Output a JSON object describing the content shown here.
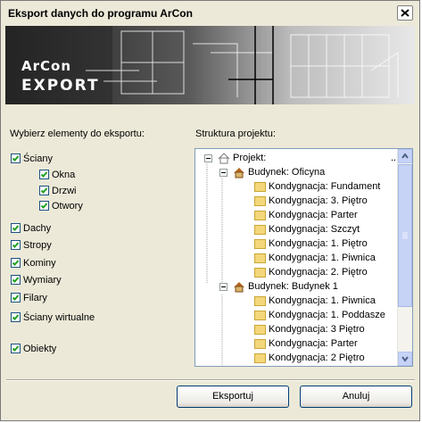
{
  "window": {
    "title": "Eksport danych do programu ArCon"
  },
  "banner": {
    "brand_line1": "ArCon",
    "brand_line2": "EXPORT"
  },
  "left": {
    "heading": "Wybierz elementy do eksportu:",
    "items": [
      {
        "label": "Ściany",
        "checked": true
      },
      {
        "label": "Okna",
        "checked": true
      },
      {
        "label": "Drzwi",
        "checked": true
      },
      {
        "label": "Otwory",
        "checked": true
      },
      {
        "label": "Dachy",
        "checked": true
      },
      {
        "label": "Stropy",
        "checked": true
      },
      {
        "label": "Kominy",
        "checked": true
      },
      {
        "label": "Wymiary",
        "checked": true
      },
      {
        "label": "Filary",
        "checked": true
      },
      {
        "label": "Ściany wirtualne",
        "checked": true
      },
      {
        "label": "Obiekty",
        "checked": true
      }
    ]
  },
  "right": {
    "heading": "Struktura projektu:",
    "tree": {
      "root": "Projekt:",
      "ellipsis": "...",
      "buildings": [
        {
          "label": "Budynek: Oficyna",
          "floors": [
            "Kondygnacja: Fundament",
            "Kondygnacja: 3. Piętro",
            "Kondygnacja: Parter",
            "Kondygnacja: Szczyt",
            "Kondygnacja: 1. Piętro",
            "Kondygnacja: 1. Piwnica",
            "Kondygnacja: 2. Piętro"
          ]
        },
        {
          "label": "Budynek: Budynek 1",
          "floors": [
            "Kondygnacja: 1. Piwnica",
            "Kondygnacja: 1. Poddasze",
            "Kondygnacja: 3 Piętro",
            "Kondygnacja: Parter",
            "Kondygnacja: 2 Piętro"
          ]
        }
      ]
    }
  },
  "buttons": {
    "export": "Eksportuj",
    "cancel": "Anuluj"
  },
  "colors": {
    "check": "#21a121",
    "folder": "#f3d77a",
    "house": "#b5651d"
  }
}
